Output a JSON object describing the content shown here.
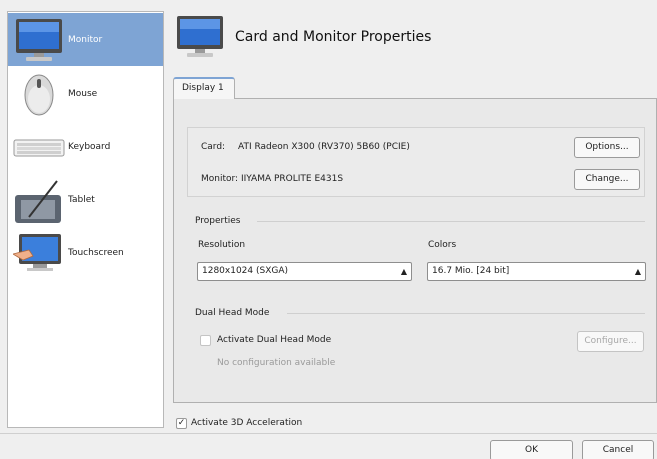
{
  "sidebar": {
    "items": [
      {
        "label": "Monitor",
        "icon": "monitor-icon",
        "selected": true
      },
      {
        "label": "Mouse",
        "icon": "mouse-icon"
      },
      {
        "label": "Keyboard",
        "icon": "keyboard-icon"
      },
      {
        "label": "Tablet",
        "icon": "tablet-icon"
      },
      {
        "label": "Touchscreen",
        "icon": "touchscreen-icon"
      }
    ]
  },
  "header": {
    "title": "Card and Monitor Properties",
    "icon": "monitor-icon"
  },
  "tabs": [
    {
      "label": "Display 1",
      "active": true
    }
  ],
  "device": {
    "card_label": "Card:",
    "card_value": "ATI Radeon X300 (RV370) 5B60 (PCIE)",
    "options_button": "Options...",
    "monitor_text": "Monitor: IIYAMA PROLITE E431S",
    "change_button": "Change..."
  },
  "properties": {
    "title": "Properties",
    "resolution_label": "Resolution",
    "resolution_value": "1280x1024 (SXGA)",
    "colors_label": "Colors",
    "colors_value": "16.7 Mio. [24 bit]"
  },
  "dual_head": {
    "title": "Dual Head Mode",
    "checkbox_label": "Activate Dual Head Mode",
    "checked": false,
    "no_config_text": "No configuration available",
    "configure_button": "Configure..."
  },
  "acceleration": {
    "label": "Activate 3D Acceleration",
    "checked": true
  },
  "footer": {
    "ok_button": "OK",
    "cancel_button": "Cancel"
  },
  "colors": {
    "selection": "#7ea4d4",
    "panel_bg": "#efefef"
  }
}
